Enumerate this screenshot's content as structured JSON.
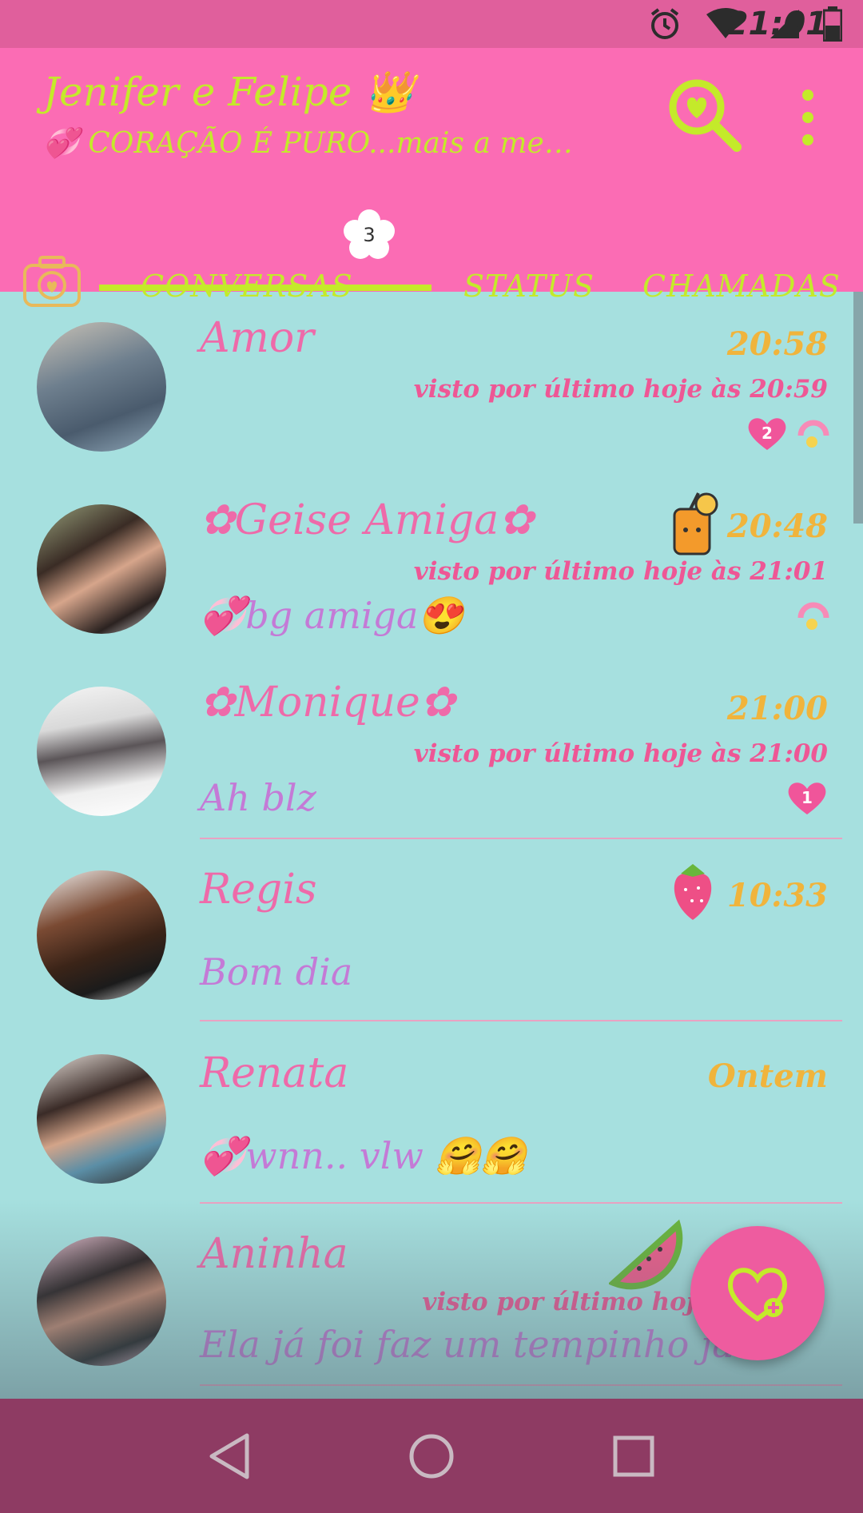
{
  "status_bar": {
    "time": "21:01"
  },
  "header": {
    "title": "Jenifer e Felipe 👑",
    "subtitle": "💞 CORAÇÃO É PURO...mais a men..."
  },
  "tabs": {
    "chats_label": "CONVERSAS",
    "chats_badge": "3",
    "status_label": "STATUS",
    "calls_label": "CHAMADAS"
  },
  "chats": [
    {
      "name": "Amor",
      "time": "20:58",
      "last_seen": "visto por último hoje às 20:59",
      "message": "",
      "unread": "2",
      "muted": true
    },
    {
      "name": "✿Geise Amiga✿",
      "time": "20:48",
      "last_seen": "visto por último hoje às 21:01",
      "message": "💞bg amiga😍",
      "unread": "",
      "muted": true
    },
    {
      "name": "✿Monique✿",
      "time": "21:00",
      "last_seen": "visto por último hoje às 21:00",
      "message": "Ah blz",
      "unread": "1",
      "muted": false
    },
    {
      "name": "Regis",
      "time": "10:33",
      "last_seen": "",
      "message": "Bom dia",
      "unread": "",
      "muted": false
    },
    {
      "name": "Renata",
      "time": "Ontem",
      "last_seen": "",
      "message": "💞wnn.. vlw 🤗🤗",
      "unread": "",
      "muted": false
    },
    {
      "name": "Aninha",
      "time": "",
      "last_seen": "visto por último hoj",
      "message": "Ela já foi faz um tempinho já",
      "unread": "",
      "muted": false
    }
  ],
  "colors": {
    "status_bar": "#e05f9c",
    "app_bar": "#fb6cb4",
    "accent_lime": "#c4ea2a",
    "list_bg": "#a6e0df",
    "name_pink": "#ee6aa9",
    "time_orange": "#f0b43c",
    "message_purple": "#c47ad6",
    "fab": "#ee5c9f",
    "nav_bar": "#8e3b63"
  },
  "icons": {
    "search": "heart-magnifier-icon",
    "menu": "overflow-menu-icon",
    "camera": "camera-icon",
    "fab": "heart-new-chat-icon",
    "nav_back": "back-triangle-icon",
    "nav_home": "home-circle-icon",
    "nav_recents": "recents-square-icon"
  }
}
